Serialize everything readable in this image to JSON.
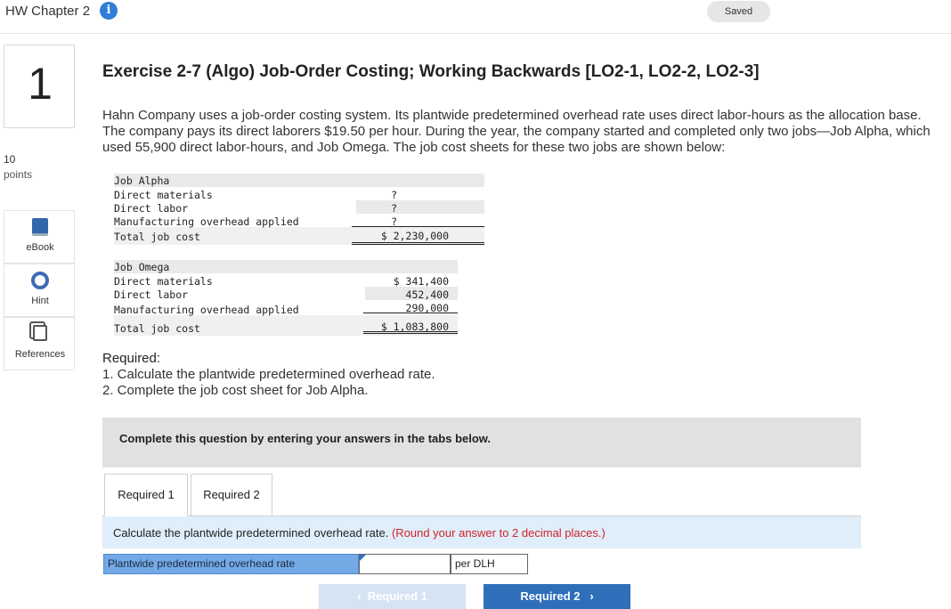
{
  "header": {
    "title": "HW Chapter 2",
    "info_icon": "i",
    "saved": "Saved"
  },
  "question": {
    "number": "1",
    "points": "10",
    "points_label": "points"
  },
  "sidebar": {
    "items": [
      {
        "label": "eBook",
        "icon": "book-icon"
      },
      {
        "label": "Hint",
        "icon": "lifebuoy-icon"
      },
      {
        "label": "References",
        "icon": "documents-icon"
      }
    ]
  },
  "exercise": {
    "title": "Exercise 2-7 (Algo) Job-Order Costing; Working Backwards [LO2-1, LO2-2, LO2-3]",
    "intro": "Hahn Company uses a job-order costing system. Its plantwide predetermined overhead rate uses direct labor-hours as the allocation base. The company pays its direct laborers $19.50 per hour. During the year, the company started and completed only two jobs—Job Alpha, which used 55,900 direct labor-hours, and Job Omega. The job cost sheets for these two jobs are shown below:"
  },
  "job_alpha": {
    "heading": "Job Alpha",
    "rows": [
      {
        "label": "Direct materials",
        "value": "?"
      },
      {
        "label": "Direct labor",
        "value": "?"
      },
      {
        "label": "Manufacturing overhead applied",
        "value": "?"
      }
    ],
    "total_label": "Total job cost",
    "total_value": "$ 2,230,000"
  },
  "job_omega": {
    "heading": "Job Omega",
    "rows": [
      {
        "label": "Direct materials",
        "value": "$ 341,400"
      },
      {
        "label": "Direct labor",
        "value": "452,400"
      },
      {
        "label": "Manufacturing overhead applied",
        "value": "290,000"
      }
    ],
    "total_label": "Total job cost",
    "total_value": "$ 1,083,800"
  },
  "required": {
    "heading": "Required",
    "items": [
      "1. Calculate the plantwide predetermined overhead rate.",
      "2. Complete the job cost sheet for Job Alpha."
    ]
  },
  "instructions": "Complete this question by entering your answers in the tabs below.",
  "tabs": [
    {
      "label": "Required 1"
    },
    {
      "label": "Required 2"
    }
  ],
  "answer": {
    "prompt": "Calculate the plantwide predetermined overhead rate.",
    "note": "(Round your answer to 2 decimal places.)",
    "label": "Plantwide predetermined overhead rate",
    "value": "",
    "unit": "per DLH"
  },
  "nav": {
    "prev": "Required 1",
    "next": "Required 2"
  },
  "colors": {
    "accent": "#2f6fba",
    "note": "#d3222a",
    "label_fill": "#74a9e6",
    "band": "#dfeefa"
  }
}
